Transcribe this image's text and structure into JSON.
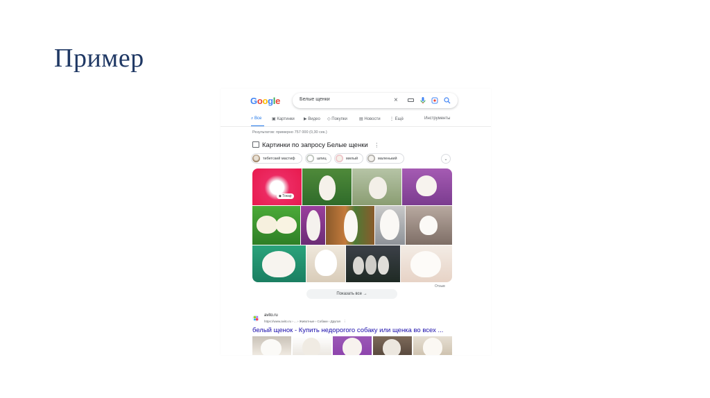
{
  "slide": {
    "title": "Пример"
  },
  "google": {
    "logo_letters": [
      {
        "ch": "G",
        "color": "#4285F4"
      },
      {
        "ch": "o",
        "color": "#EA4335"
      },
      {
        "ch": "o",
        "color": "#FBBC05"
      },
      {
        "ch": "g",
        "color": "#4285F4"
      },
      {
        "ch": "l",
        "color": "#34A853"
      },
      {
        "ch": "e",
        "color": "#EA4335"
      }
    ],
    "search_query": "Белые щенки",
    "icons": [
      "close-icon",
      "keyboard-icon",
      "mic-icon",
      "lens-icon",
      "search-icon"
    ],
    "tabs": [
      {
        "label": "Все",
        "icon": "search-icon",
        "active": true
      },
      {
        "label": "Картинки",
        "icon": "image-icon"
      },
      {
        "label": "Видео",
        "icon": "video-icon"
      },
      {
        "label": "Покупки",
        "icon": "tag-icon"
      },
      {
        "label": "Новости",
        "icon": "news-icon"
      },
      {
        "label": "Ещё",
        "icon": "more-icon"
      }
    ],
    "tools_label": "Инструменты",
    "stats": "Результатов: примерно 757 000 (0,30 сек.)",
    "images_heading": "Картинки по запросу Белые щенки",
    "chips": [
      "тибетский мастиф",
      "шпиц",
      "милый",
      "маленький"
    ],
    "image_tag": "Токар",
    "feedback": "Отзыв",
    "show_all": "Показать все",
    "result": {
      "site": "avito.ru",
      "url": "https://www.avito.ru › ... › Животные › Собаки › Другая",
      "title": "белый щенок - Купить недорогого собаку или щенка во всех ..."
    }
  },
  "colors": {
    "slide_title": "#1f3864",
    "link": "#1a0dab",
    "accent": "#1a73e8"
  }
}
